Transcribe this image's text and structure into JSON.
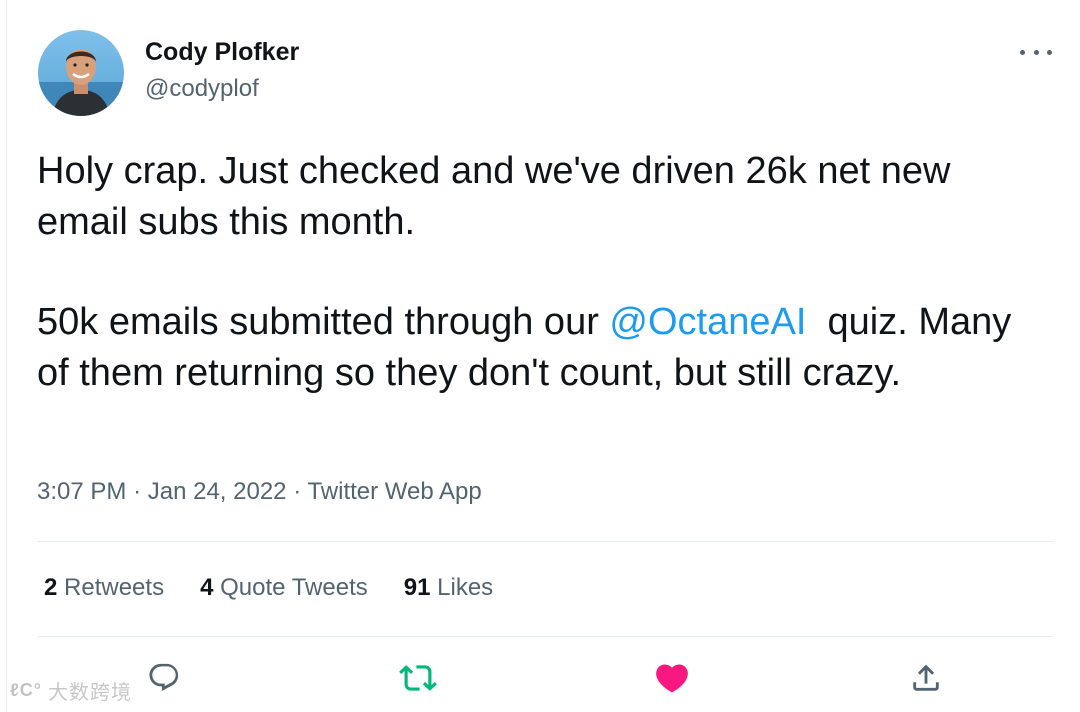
{
  "user": {
    "name": "Cody Plofker",
    "handle": "@codyplof"
  },
  "tweet": {
    "line1": "Holy crap. Just checked and we've driven 26k net new email subs this month.",
    "line2_before": "50k emails submitted through our ",
    "mention": "@OctaneAI",
    "line2_after": "  quiz. Many of them returning so they don't count, but still crazy."
  },
  "meta": {
    "time": "3:07 PM",
    "date": "Jan 24, 2022",
    "source": "Twitter Web App"
  },
  "stats": {
    "retweets_count": "2",
    "retweets_label": "Retweets",
    "quotes_count": "4",
    "quotes_label": "Quote Tweets",
    "likes_count": "91",
    "likes_label": "Likes"
  },
  "actions": {
    "reply_icon": "reply-icon",
    "retweet_icon": "retweet-icon",
    "like_icon": "heart-icon",
    "share_icon": "share-icon"
  },
  "watermark": {
    "text": "大数跨境"
  },
  "colors": {
    "link": "#1d9bf0",
    "retweet": "#00ba7c",
    "like": "#f91880",
    "secondary": "#536471"
  }
}
